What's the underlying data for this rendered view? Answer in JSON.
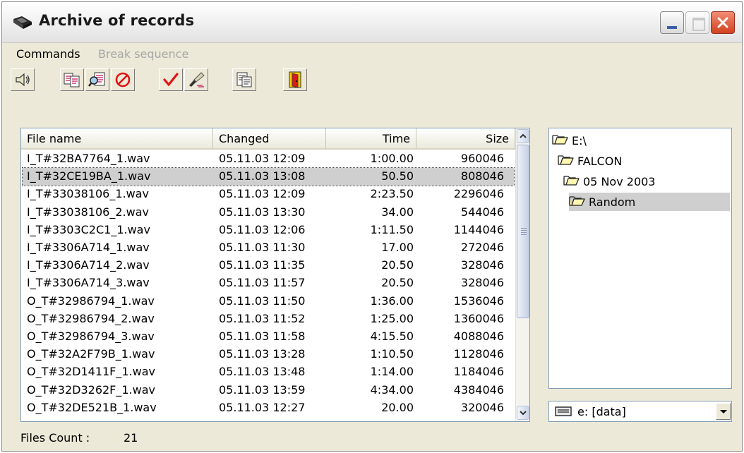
{
  "window": {
    "title": "Archive of records"
  },
  "menu": {
    "commands": "Commands",
    "break_sequence": "Break sequence"
  },
  "toolbar": {
    "buttons": [
      "speaker-icon",
      "copy-records-icon",
      "find-records-icon",
      "stop-icon",
      "checkmark-icon",
      "erase-icon",
      "properties-icon",
      "exit-door-icon"
    ]
  },
  "table": {
    "columns": {
      "name": "File name",
      "changed": "Changed",
      "time": "Time",
      "size": "Size"
    },
    "selected_index": 1,
    "rows": [
      {
        "name": "I_T#32BA7764_1.wav",
        "changed": "05.11.03 12:09",
        "time": "1:00.00",
        "size": "960046"
      },
      {
        "name": "I_T#32CE19BA_1.wav",
        "changed": "05.11.03 13:08",
        "time": "50.50",
        "size": "808046"
      },
      {
        "name": "I_T#33038106_1.wav",
        "changed": "05.11.03 12:09",
        "time": "2:23.50",
        "size": "2296046"
      },
      {
        "name": "I_T#33038106_2.wav",
        "changed": "05.11.03 13:30",
        "time": "34.00",
        "size": "544046"
      },
      {
        "name": "I_T#3303C2C1_1.wav",
        "changed": "05.11.03 12:06",
        "time": "1:11.50",
        "size": "1144046"
      },
      {
        "name": "I_T#3306A714_1.wav",
        "changed": "05.11.03 11:30",
        "time": "17.00",
        "size": "272046"
      },
      {
        "name": "I_T#3306A714_2.wav",
        "changed": "05.11.03 11:35",
        "time": "20.50",
        "size": "328046"
      },
      {
        "name": "I_T#3306A714_3.wav",
        "changed": "05.11.03 11:57",
        "time": "20.50",
        "size": "328046"
      },
      {
        "name": "O_T#32986794_1.wav",
        "changed": "05.11.03 11:50",
        "time": "1:36.00",
        "size": "1536046"
      },
      {
        "name": "O_T#32986794_2.wav",
        "changed": "05.11.03 11:52",
        "time": "1:25.00",
        "size": "1360046"
      },
      {
        "name": "O_T#32986794_3.wav",
        "changed": "05.11.03 11:58",
        "time": "4:15.50",
        "size": "4088046"
      },
      {
        "name": "O_T#32A2F79B_1.wav",
        "changed": "05.11.03 13:28",
        "time": "1:10.50",
        "size": "1128046"
      },
      {
        "name": "O_T#32D1411F_1.wav",
        "changed": "05.11.03 13:48",
        "time": "1:14.00",
        "size": "1184046"
      },
      {
        "name": "O_T#32D3262F_1.wav",
        "changed": "05.11.03 13:59",
        "time": "4:34.00",
        "size": "4384046"
      },
      {
        "name": "O_T#32DE521B_1.wav",
        "changed": "05.11.03 12:27",
        "time": "20.00",
        "size": "320046"
      }
    ]
  },
  "tree": {
    "nodes": [
      {
        "label": "E:\\",
        "depth": 0,
        "open": true
      },
      {
        "label": "FALCON",
        "depth": 1,
        "open": true
      },
      {
        "label": "05 Nov 2003",
        "depth": 2,
        "open": true
      },
      {
        "label": "Random",
        "depth": 3,
        "open": true,
        "selected": true
      }
    ]
  },
  "drive": {
    "label": "e: [data]"
  },
  "status": {
    "files_count_label": "Files Count :",
    "files_count": "21"
  }
}
